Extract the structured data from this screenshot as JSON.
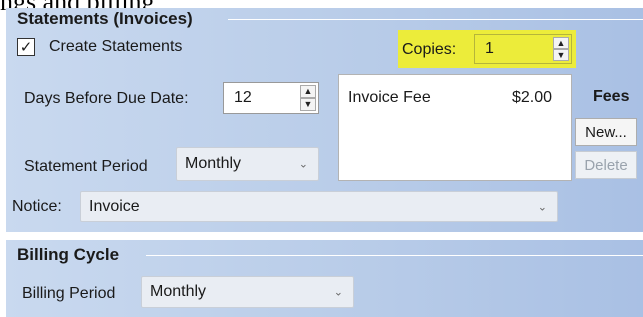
{
  "caption": "ngs and billing",
  "statements": {
    "group_title": "Statements (Invoices)",
    "create_statements": {
      "label": "Create Statements",
      "checked": true,
      "check_glyph": "✓"
    },
    "copies": {
      "label": "Copies:",
      "value": "1"
    },
    "days_before_due": {
      "label": "Days Before Due Date:",
      "value": "12"
    },
    "fees": {
      "label": "Fees",
      "items": [
        {
          "name": "Invoice Fee",
          "amount": "$2.00"
        }
      ],
      "new_label": "New...",
      "delete_label": "Delete"
    },
    "statement_period": {
      "label": "Statement Period",
      "value": "Monthly"
    },
    "notice": {
      "label": "Notice:",
      "value": "Invoice"
    }
  },
  "billing_cycle": {
    "group_title": "Billing Cycle",
    "billing_period": {
      "label": "Billing Period",
      "value": "Monthly"
    }
  },
  "icons": {
    "spin_up": "▲",
    "spin_down": "▼",
    "chevron": "⌄"
  },
  "colors": {
    "panel": "#b7cbe8",
    "highlight": "#ecec3a"
  }
}
